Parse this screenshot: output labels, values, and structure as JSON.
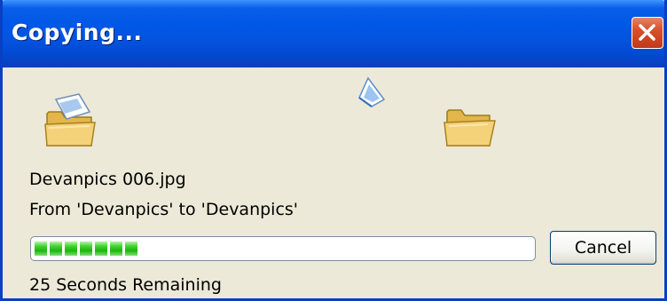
{
  "window": {
    "title": "Copying...",
    "close_icon": "close-icon"
  },
  "icons": {
    "source": "open-folder-with-document-icon",
    "flying": "flying-document-icon",
    "destination": "open-folder-icon"
  },
  "file": {
    "name": "Devanpics 006.jpg",
    "from_to": "From 'Devanpics' to 'Devanpics'"
  },
  "progress": {
    "blocks_filled": 7,
    "fraction": 0.2
  },
  "buttons": {
    "cancel_label": "Cancel"
  },
  "status": {
    "remaining": "25 Seconds Remaining"
  },
  "colors": {
    "titlebar": "#0058e6",
    "dialog_background": "#ece9d8",
    "progress_green": "#1fb311",
    "close_button": "#d8502a"
  }
}
